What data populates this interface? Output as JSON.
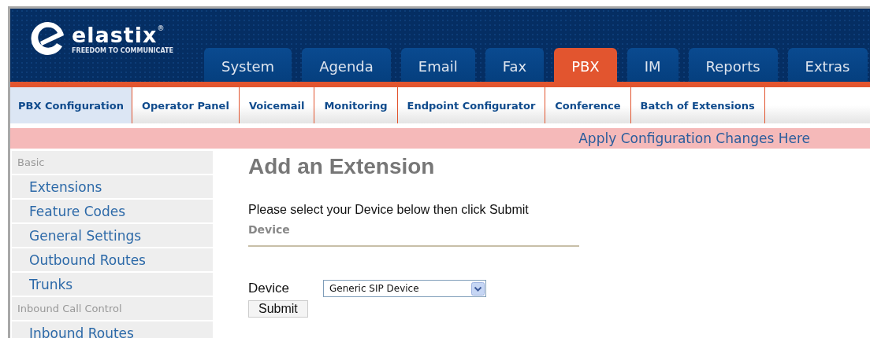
{
  "logo": {
    "name": "elastix",
    "mark": "®",
    "tagline": "FREEDOM TO COMMUNICATE"
  },
  "tabs": [
    {
      "label": "System",
      "selected": false
    },
    {
      "label": "Agenda",
      "selected": false
    },
    {
      "label": "Email",
      "selected": false
    },
    {
      "label": "Fax",
      "selected": false
    },
    {
      "label": "PBX",
      "selected": true
    },
    {
      "label": "IM",
      "selected": false
    },
    {
      "label": "Reports",
      "selected": false
    },
    {
      "label": "Extras",
      "selected": false
    }
  ],
  "subtabs": [
    {
      "label": "PBX Configuration",
      "selected": true
    },
    {
      "label": "Operator Panel",
      "selected": false
    },
    {
      "label": "Voicemail",
      "selected": false
    },
    {
      "label": "Monitoring",
      "selected": false
    },
    {
      "label": "Endpoint Configurator",
      "selected": false
    },
    {
      "label": "Conference",
      "selected": false
    },
    {
      "label": "Batch of Extensions",
      "selected": false
    }
  ],
  "apply_link": "Apply Configuration Changes Here",
  "sidebar": {
    "sections": [
      {
        "title": "Basic",
        "items": [
          "Extensions",
          "Feature Codes",
          "General Settings",
          "Outbound Routes",
          "Trunks"
        ]
      },
      {
        "title": "Inbound Call Control",
        "items": [
          "Inbound Routes"
        ]
      }
    ]
  },
  "main": {
    "title": "Add an Extension",
    "instruction": "Please select your Device below then click Submit",
    "section": "Device",
    "field_label": "Device",
    "device_select": {
      "value": "Generic SIP Device"
    },
    "submit": "Submit"
  }
}
